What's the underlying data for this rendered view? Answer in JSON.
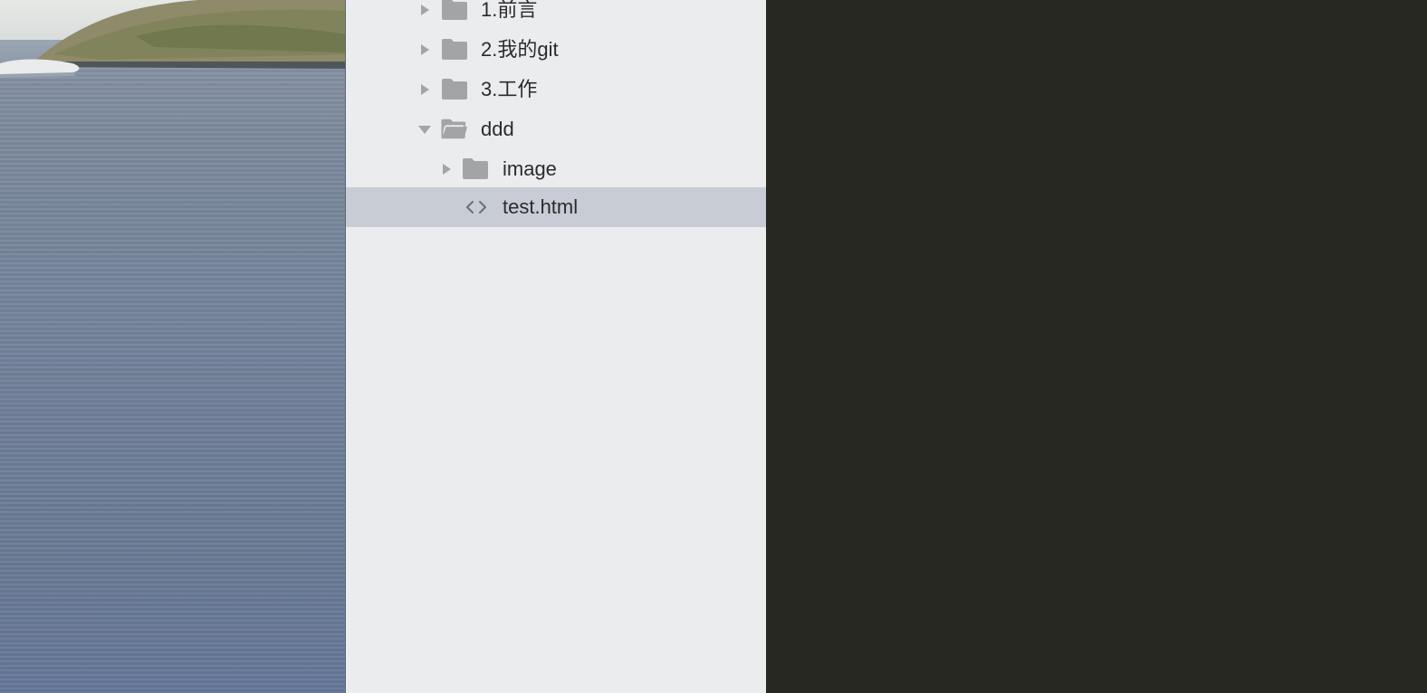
{
  "sidebar": {
    "items": [
      {
        "label": "1.前言",
        "type": "folder",
        "expanded": false
      },
      {
        "label": "2.我的git",
        "type": "folder",
        "expanded": false
      },
      {
        "label": "3.工作",
        "type": "folder",
        "expanded": false
      },
      {
        "label": "ddd",
        "type": "folder",
        "expanded": true
      },
      {
        "label": "image",
        "type": "folder",
        "expanded": false
      },
      {
        "label": "test.html",
        "type": "file",
        "selected": true
      }
    ]
  },
  "colors": {
    "sidebar_bg": "#ebecee",
    "selected_row_bg": "#c8ccd5",
    "editor_bg": "#272822",
    "icon_gray": "#a3a4a6"
  },
  "icons": {
    "collapsed": "disclosure-right-icon",
    "expanded": "disclosure-down-icon",
    "folder": "folder-icon",
    "open_folder": "folder-open-icon",
    "file": "code-file-icon"
  }
}
